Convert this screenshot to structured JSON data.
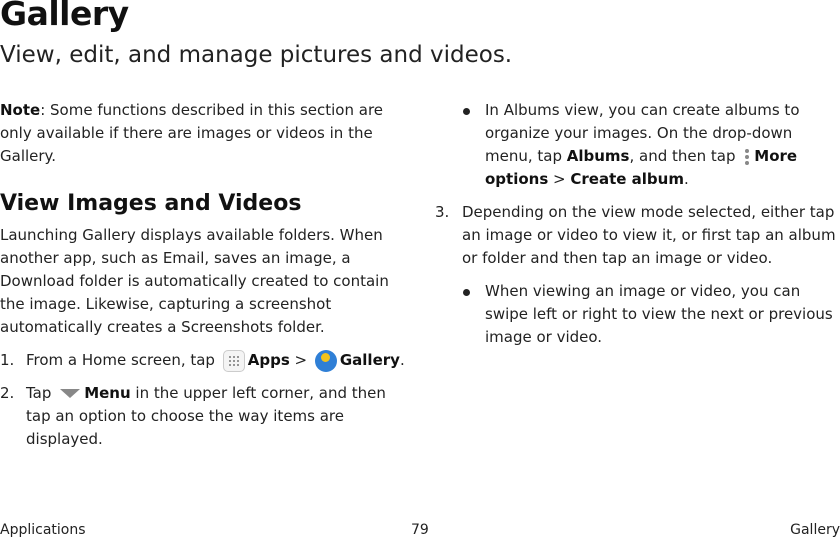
{
  "header": {
    "title": "Gallery",
    "subtitle": "View, edit, and manage pictures and videos."
  },
  "note": {
    "label": "Note",
    "text": ": Some functions described in this section are only available if there are images or videos in the Gallery."
  },
  "section": {
    "heading": "View Images and Videos",
    "intro": "Launching Gallery displays available folders. When another app, such as Email, saves an image, a Download folder is automatically created to contain the image. Likewise, capturing a screenshot automatically creates a Screenshots folder."
  },
  "steps": {
    "s1_num": "1.",
    "s1_a": "From a Home screen, tap",
    "s1_apps": "Apps",
    "s1_sep": " > ",
    "s1_gallery": "Gallery",
    "s1_end": ".",
    "s2_num": "2.",
    "s2_a": "Tap",
    "s2_menu": "Menu",
    "s2_b": " in the upper left corner, and then tap an option to choose the way items are displayed.",
    "b1_a": "In Albums view, you can create albums to organize your images. On the drop-down menu, tap ",
    "b1_albums": "Albums",
    "b1_b": ", and then tap",
    "b1_more": "More options",
    "b1_sep": " > ",
    "b1_create": "Create album",
    "b1_end": ".",
    "s3_num": "3.",
    "s3_text": "Depending on the view mode selected, either tap an image or video to view it, or first tap an album or folder and then tap an image or video.",
    "b2_text": "When viewing an image or video, you can swipe left or right to view the next or previous image or video."
  },
  "footer": {
    "left": "Applications",
    "page": "79",
    "right": "Gallery"
  },
  "icons": {
    "apps": "apps-icon",
    "gallery": "gallery-icon",
    "menu": "menu-icon",
    "more": "more-options-icon"
  }
}
